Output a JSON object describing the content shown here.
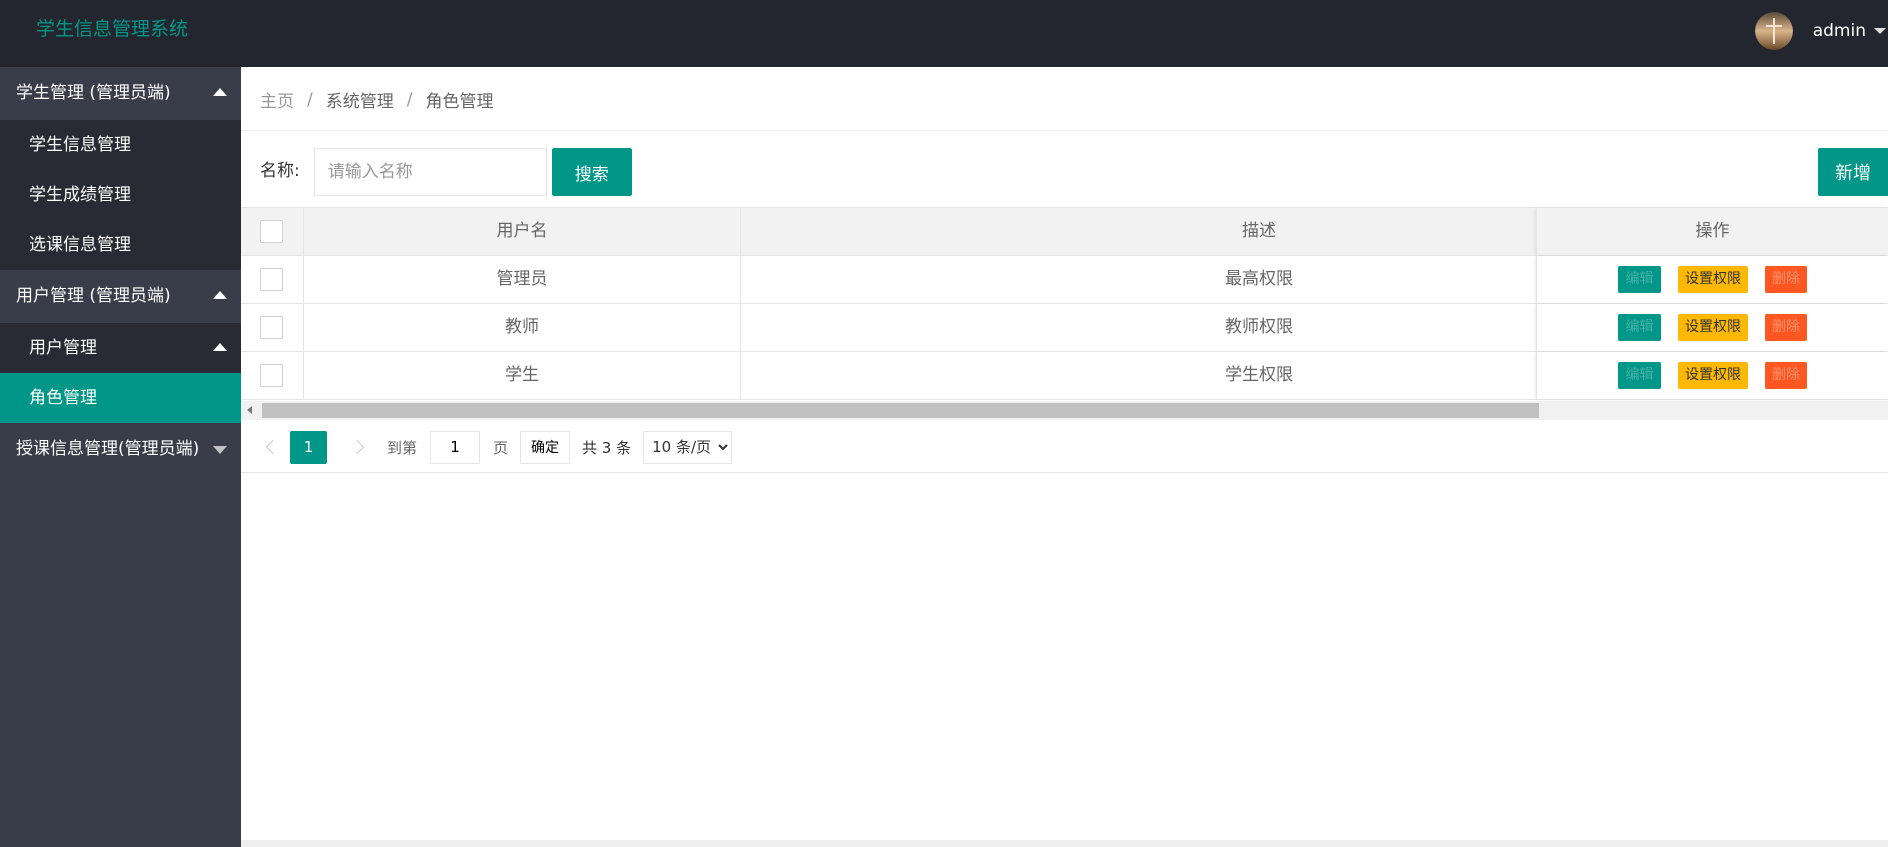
{
  "app": {
    "title": "学生信息管理系统"
  },
  "user": {
    "name": "admin",
    "avatar_icon": "user-avatar"
  },
  "sidebar": {
    "groups": [
      {
        "label": "学生管理 (管理员端)",
        "expanded": true,
        "items": [
          {
            "label": "学生信息管理"
          },
          {
            "label": "学生成绩管理"
          },
          {
            "label": "选课信息管理"
          }
        ]
      },
      {
        "label": "用户管理 (管理员端)",
        "expanded": true,
        "items": [
          {
            "label": "用户管理"
          },
          {
            "label": "角色管理",
            "active": true
          }
        ]
      },
      {
        "label": "授课信息管理(管理员端)",
        "expanded": false
      }
    ]
  },
  "breadcrumb": {
    "home": "主页",
    "sep": "/",
    "level1": "系统管理",
    "level2": "角色管理"
  },
  "search": {
    "label": "名称:",
    "placeholder": "请输入名称",
    "button": "搜索"
  },
  "toolbar": {
    "add_label": "新增"
  },
  "table": {
    "headers": {
      "name": "用户名",
      "desc": "描述",
      "ops": "操作"
    },
    "rows": [
      {
        "name": "管理员",
        "desc": "最高权限"
      },
      {
        "name": "教师",
        "desc": "教师权限"
      },
      {
        "name": "学生",
        "desc": "学生权限"
      }
    ],
    "actions": {
      "edit": "编辑",
      "perm": "设置权限",
      "delete": "删除"
    }
  },
  "pagination": {
    "current": "1",
    "goto_label": "到第",
    "page_value": "1",
    "page_unit": "页",
    "ok": "确定",
    "total": "共 3 条",
    "page_size": "10 条/页"
  },
  "colors": {
    "primary": "#009688",
    "warm": "#ffb800",
    "danger": "#ff5722",
    "header_bg": "#23262e",
    "sidebar_bg": "#393d49"
  }
}
